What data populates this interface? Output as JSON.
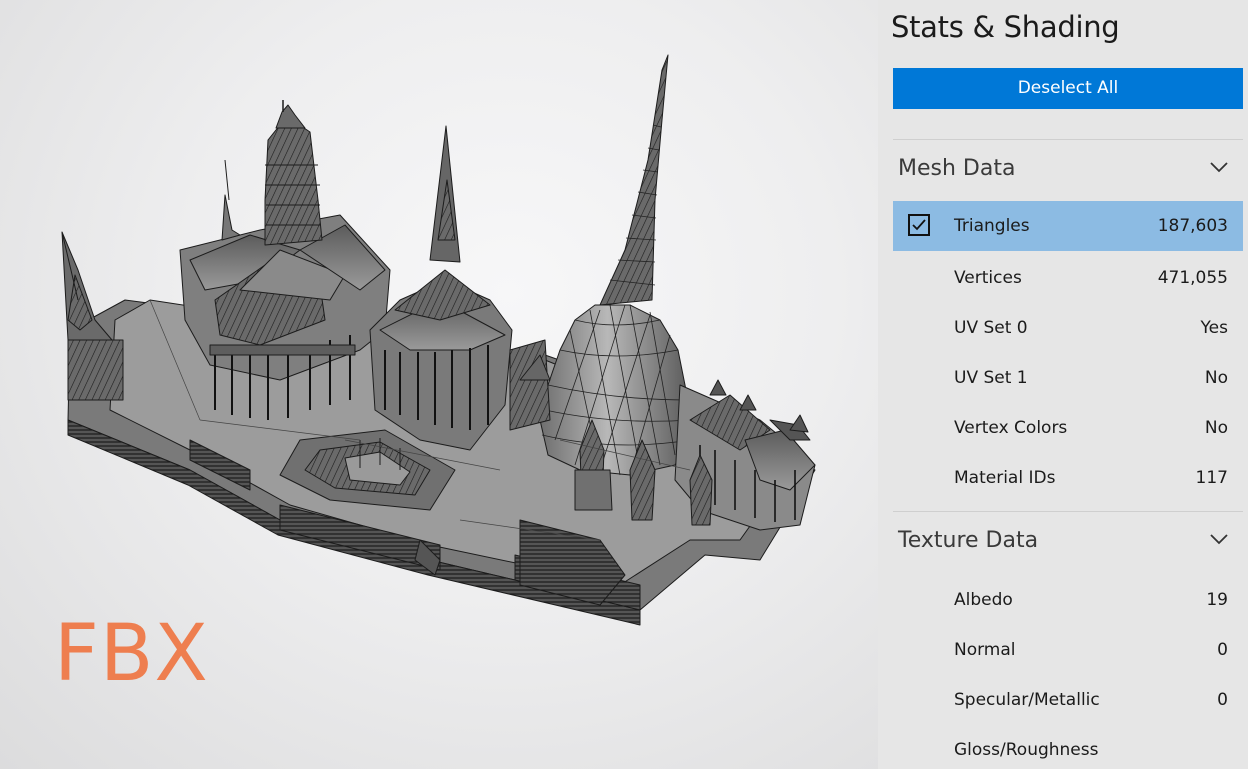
{
  "viewport": {
    "format_label": "FBX",
    "colors": {
      "format_label": "#ee7e4f",
      "mesh_fill": "#8e8e8e",
      "wire": "#1c1c1c"
    }
  },
  "panel": {
    "title": "Stats & Shading",
    "deselect_button": "Deselect All",
    "colors": {
      "accent": "#0078d7",
      "selected_row": "#8cbbe3",
      "background": "#e6e6e6"
    },
    "sections": {
      "mesh": {
        "title": "Mesh Data",
        "icon": "chevron-down-icon",
        "rows": [
          {
            "label": "Triangles",
            "value": "187,603",
            "selected": true,
            "checked": true
          },
          {
            "label": "Vertices",
            "value": "471,055"
          },
          {
            "label": "UV Set 0",
            "value": "Yes"
          },
          {
            "label": "UV Set 1",
            "value": "No"
          },
          {
            "label": "Vertex Colors",
            "value": "No"
          },
          {
            "label": "Material IDs",
            "value": "117"
          }
        ]
      },
      "texture": {
        "title": "Texture Data",
        "icon": "chevron-down-icon",
        "rows": [
          {
            "label": "Albedo",
            "value": "19"
          },
          {
            "label": "Normal",
            "value": "0"
          },
          {
            "label": "Specular/Metallic",
            "value": "0"
          },
          {
            "label": "Gloss/Roughness",
            "value": ""
          }
        ]
      }
    }
  }
}
